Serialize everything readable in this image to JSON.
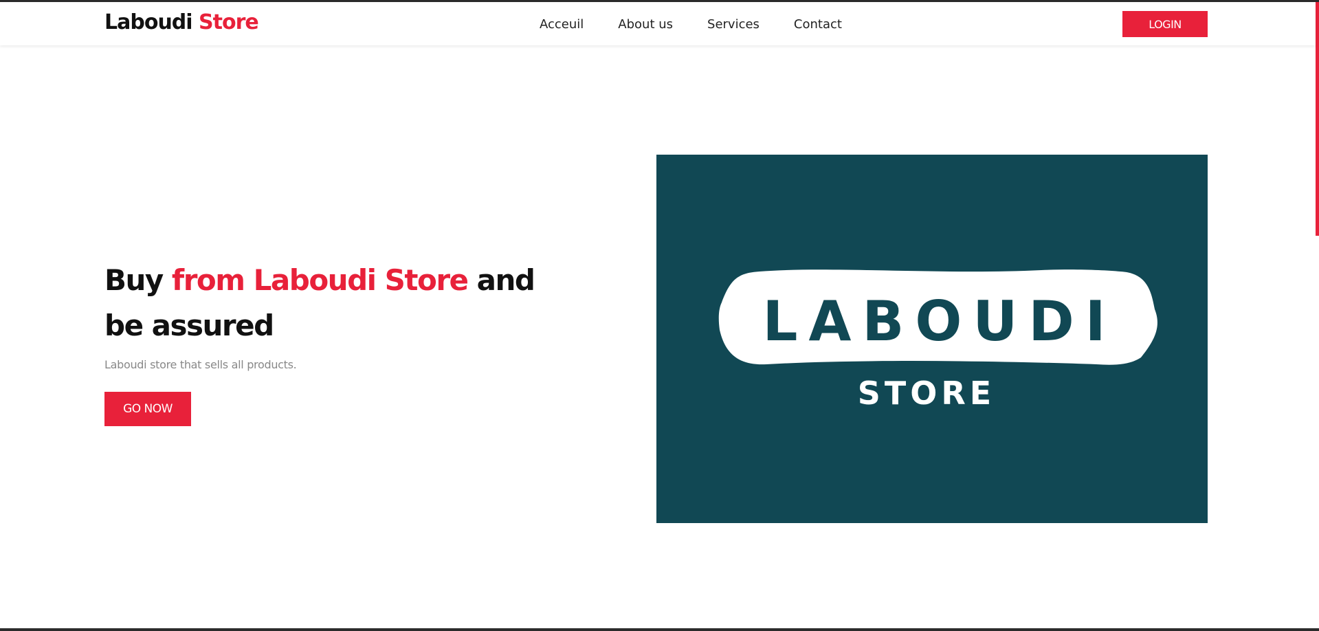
{
  "header": {
    "logo_part1": "Laboudi ",
    "logo_part2": "Store",
    "nav": [
      {
        "label": "Acceuil"
      },
      {
        "label": "About us"
      },
      {
        "label": "Services"
      },
      {
        "label": "Contact"
      }
    ],
    "login_label": "LOGIN"
  },
  "hero": {
    "title_part1": "Buy ",
    "title_part2": "from Laboudi Store",
    "title_part3": " and be assured",
    "subtitle": "Laboudi store that sells all products.",
    "cta_label": "GO NOW"
  },
  "brand_image": {
    "line1": "LABOUDI",
    "line2": "STORE",
    "background_color": "#114854"
  },
  "colors": {
    "accent": "#e8213a",
    "text": "#111111",
    "muted": "#888888",
    "brand_teal": "#114854"
  }
}
